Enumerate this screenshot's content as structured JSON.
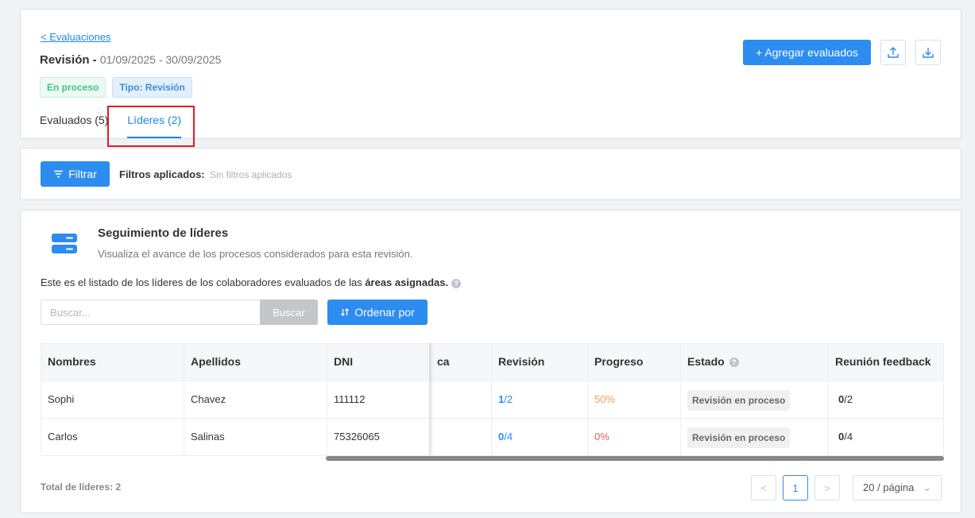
{
  "header": {
    "back_link": "< Evaluaciones",
    "title": "Revisión - ",
    "date_range": "01/09/2025 - 30/09/2025",
    "badge_status": "En proceso",
    "badge_type": "Tipo: Revisión",
    "tabs": [
      {
        "label": "Evaluados (5)",
        "active": false
      },
      {
        "label": "Líderes (2)",
        "active": true
      }
    ],
    "add_button_label": "+ Agregar evaluados",
    "upload_icon": "upload-icon",
    "download_icon": "download-icon",
    "highlight_color": "#e31b23"
  },
  "filters": {
    "filter_button_label": "Filtrar",
    "applied_label": "Filtros aplicados:",
    "applied_value": "Sin filtros aplicados"
  },
  "section": {
    "title": "Seguimiento de líderes",
    "subtitle": "Visualiza el avance de los procesos considerados para esta revisión.",
    "intro_prefix": "Este es el listado de los líderes de los colaboradores evaluados de las ",
    "intro_bold": "áreas asignadas.",
    "help_glyph": "?"
  },
  "search": {
    "placeholder": "Buscar...",
    "button_label": "Buscar",
    "sort_label": "Ordenar por"
  },
  "table": {
    "fixed_columns": [
      "Nombres",
      "Apellidos",
      "DNI"
    ],
    "scroll_columns": [
      "ca",
      "Revisión",
      "Progreso",
      "Estado",
      "Reunión feedback"
    ],
    "rows": [
      {
        "nombres": "Sophi",
        "apellidos": "Chavez",
        "dni": "111112",
        "rev_done": "1",
        "rev_total": "/2",
        "progreso": "50%",
        "estado": "Revisión en proceso",
        "feedback_done": "0",
        "feedback_total": "/2"
      },
      {
        "nombres": "Carlos",
        "apellidos": "Salinas",
        "dni": "75326065",
        "rev_done": "0",
        "rev_total": "/4",
        "progreso": "0%",
        "estado": "Revisión en proceso",
        "feedback_done": "0",
        "feedback_total": "/4"
      }
    ]
  },
  "footer": {
    "total_label": "Total de líderes: 2",
    "prev": "<",
    "current_page": "1",
    "next": ">",
    "page_size": "20 / página",
    "page_size_chevron": "⌄"
  },
  "colors": {
    "primary": "#2d8cf0",
    "success": "#3fc585",
    "warning": "#f0a050",
    "danger": "#e06060"
  }
}
